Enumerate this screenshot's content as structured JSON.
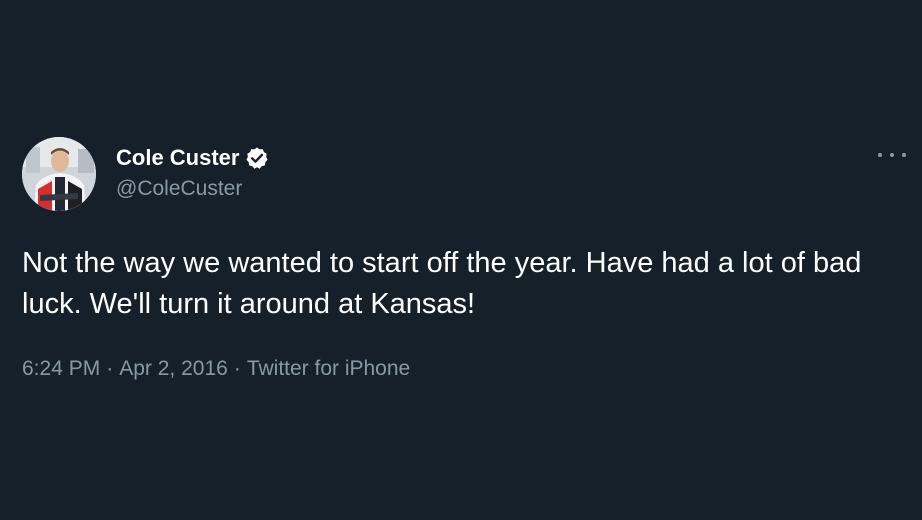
{
  "tweet": {
    "author": {
      "display_name": "Cole Custer",
      "handle": "@ColeCuster",
      "verified_icon": "verified-badge-icon"
    },
    "more_icon": "more-options-icon",
    "text": "Not the way we wanted to start off the year. Have had a lot of bad luck. We'll turn it around at Kansas!",
    "time": "6:24 PM",
    "date": "Apr 2, 2016",
    "source": "Twitter for iPhone",
    "separator": "·"
  },
  "colors": {
    "background": "#15202b",
    "primary_text": "#ffffff",
    "secondary_text": "#8899a6"
  }
}
